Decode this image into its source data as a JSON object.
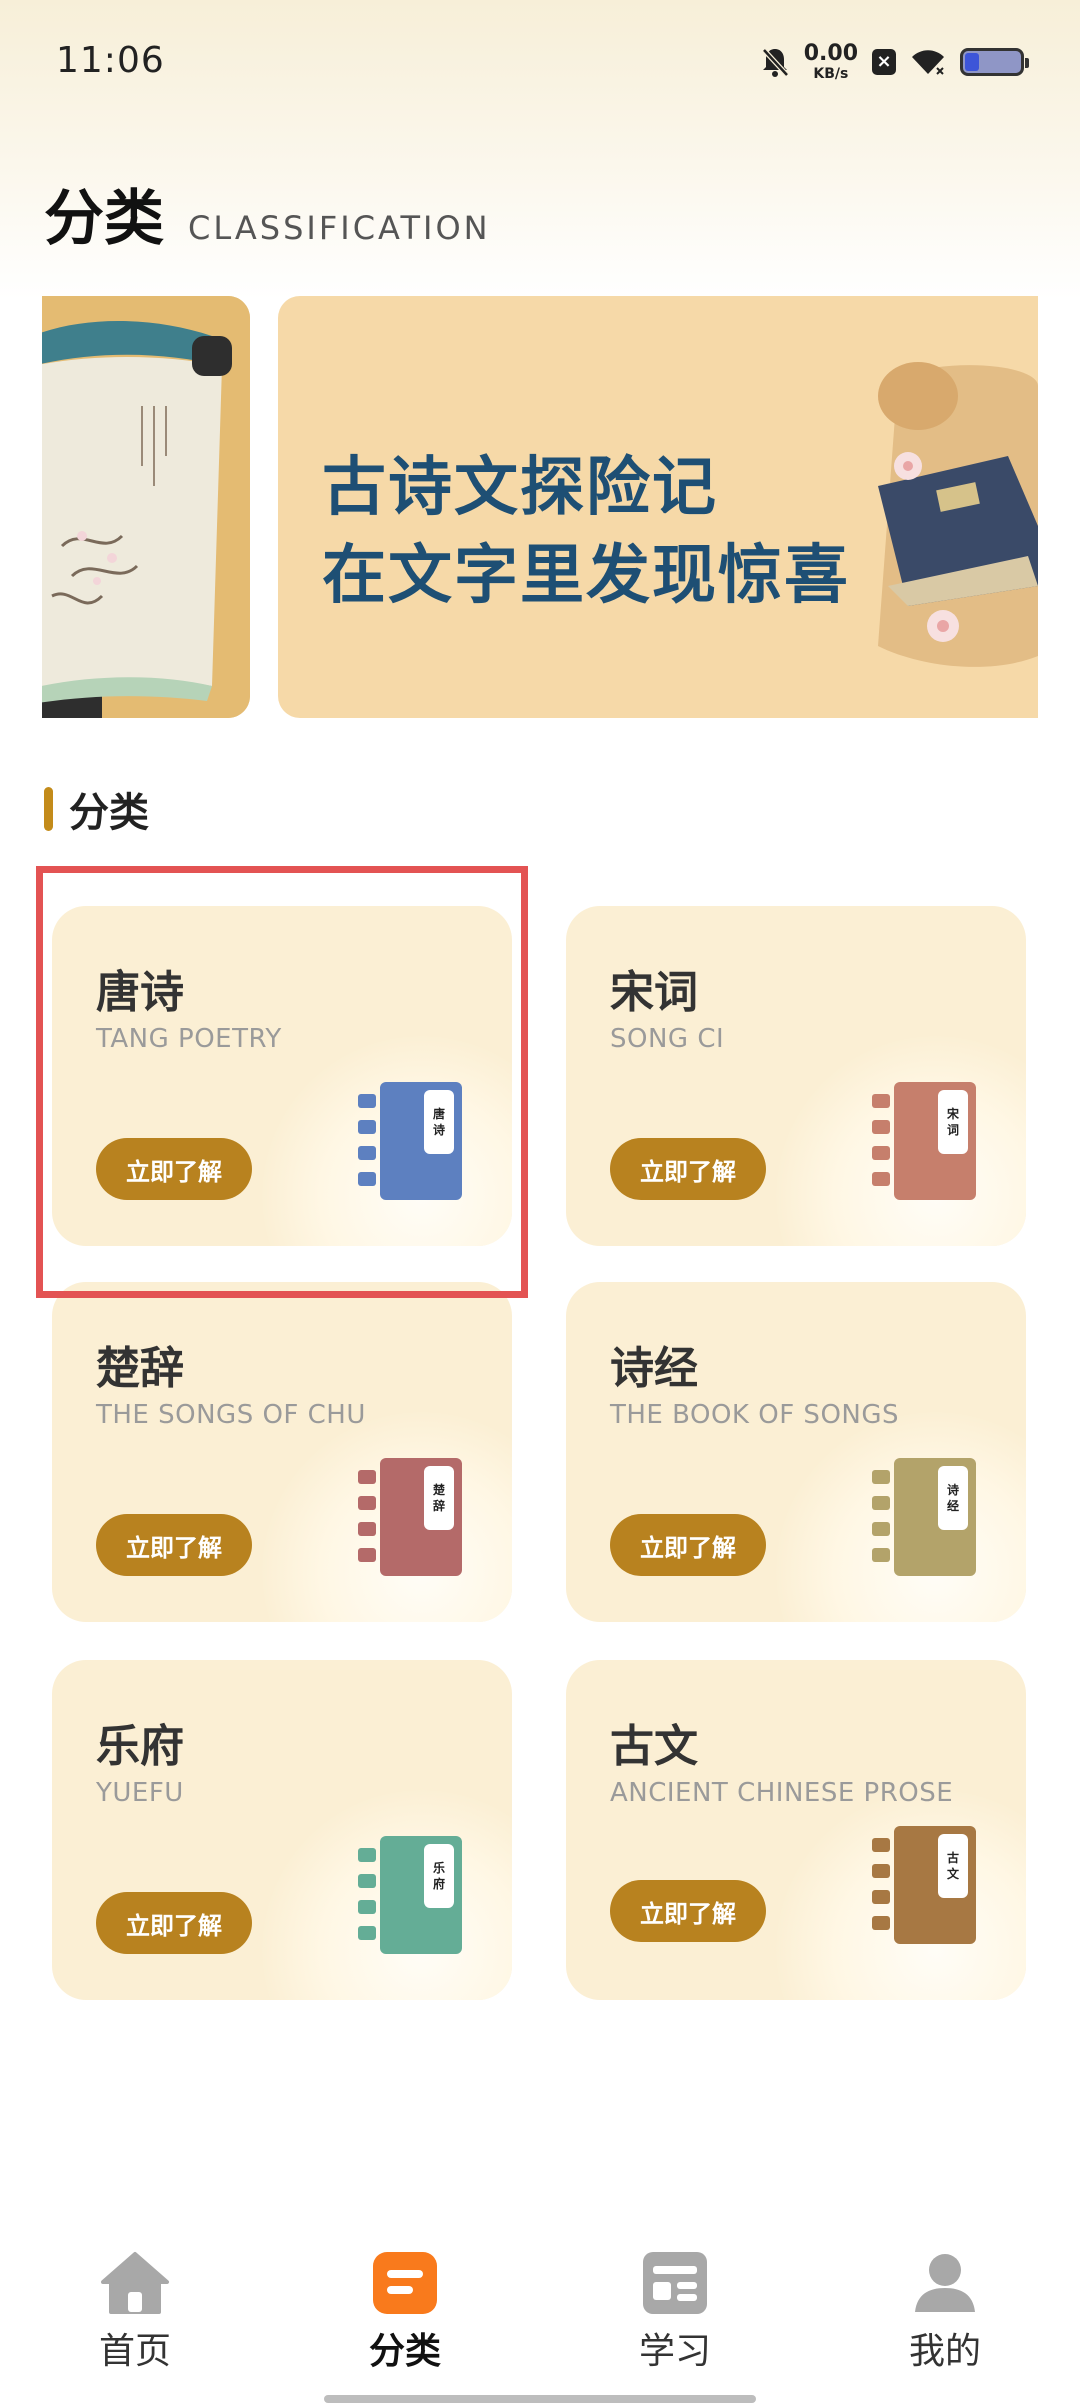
{
  "status_bar": {
    "time": "11:06",
    "net_speed": "0.00",
    "net_unit": "KB/s",
    "icons": [
      "mute-bell-icon",
      "close-square-icon",
      "wifi-icon",
      "battery-icon"
    ]
  },
  "header": {
    "title": "分类",
    "subtitle": "CLASSIFICATION"
  },
  "banner": {
    "line1": "古诗文探险记",
    "line2": "在文字里发现惊喜"
  },
  "section": {
    "title": "分类"
  },
  "categories": [
    {
      "title": "唐诗",
      "subtitle": "TANG POETRY",
      "button": "立即了解",
      "book_label": "唐诗",
      "book_color": "#5d80c0",
      "tab_color": "#5d80c0"
    },
    {
      "title": "宋词",
      "subtitle": "SONG CI",
      "button": "立即了解",
      "book_label": "宋词",
      "book_color": "#c67f6c",
      "tab_color": "#c67f6c"
    },
    {
      "title": "楚辞",
      "subtitle": "THE SONGS OF CHU",
      "button": "立即了解",
      "book_label": "楚辞",
      "book_color": "#b46a69",
      "tab_color": "#b46a69"
    },
    {
      "title": "诗经",
      "subtitle": "THE BOOK OF SONGS",
      "button": "立即了解",
      "book_label": "诗经",
      "book_color": "#b3a36a",
      "tab_color": "#b3a36a"
    },
    {
      "title": "乐府",
      "subtitle": "YUEFU",
      "button": "立即了解",
      "book_label": "乐府",
      "book_color": "#64ad96",
      "tab_color": "#64ad96"
    },
    {
      "title": "古文",
      "subtitle": "ANCIENT CHINESE PROSE",
      "button": "立即了解",
      "book_label": "古文",
      "book_color": "#a77843",
      "tab_color": "#a77843"
    }
  ],
  "bottom_nav": {
    "items": [
      {
        "label": "首页",
        "icon": "home-icon",
        "active": false
      },
      {
        "label": "分类",
        "icon": "category-icon",
        "active": true
      },
      {
        "label": "学习",
        "icon": "study-icon",
        "active": false
      },
      {
        "label": "我的",
        "icon": "profile-icon",
        "active": false
      }
    ]
  },
  "colors": {
    "accent": "#b8821f",
    "active_tab": "#f97a1c",
    "inactive_icon": "#a8a8a8",
    "highlight": "#e35353",
    "card_bg": "#fbefd4"
  }
}
